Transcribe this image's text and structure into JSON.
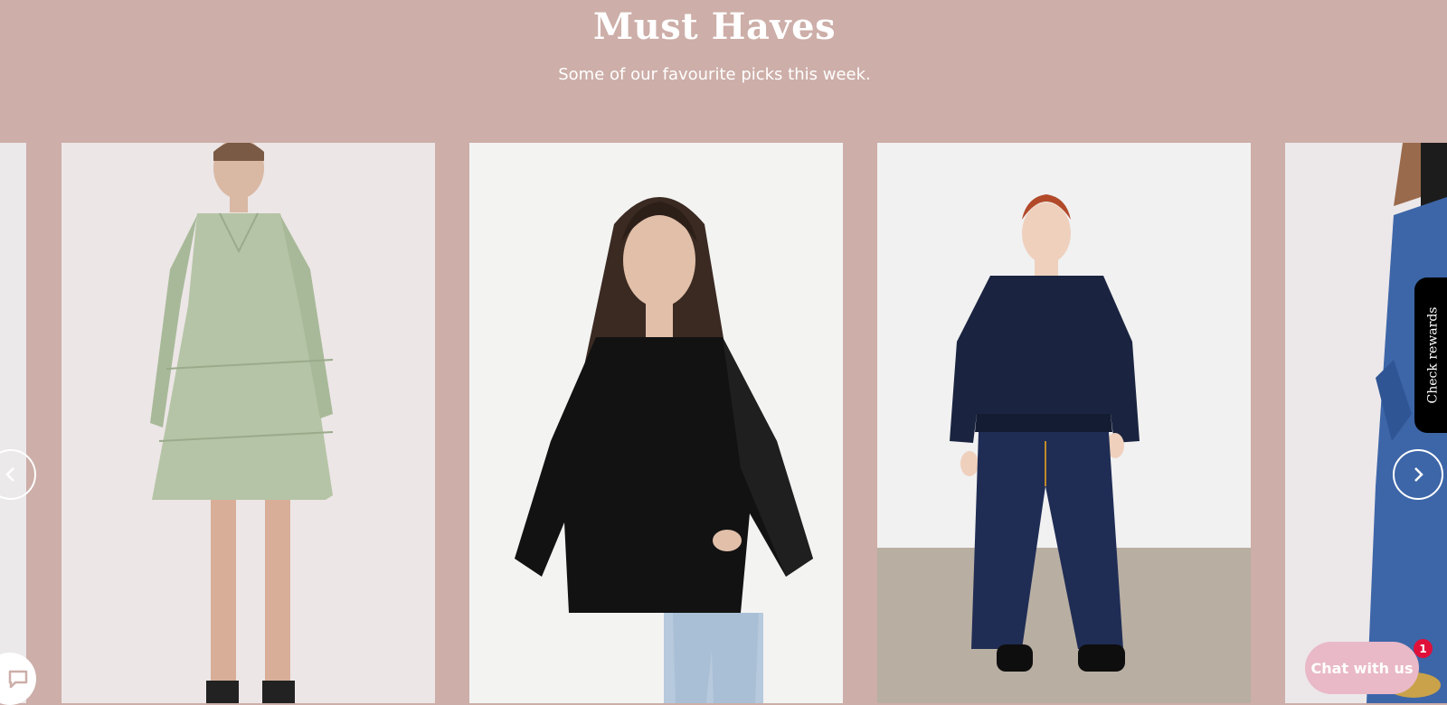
{
  "section": {
    "title": "Must Haves",
    "subtitle": "Some of our favourite picks this week."
  },
  "carousel": {
    "prev_icon": "chevron-left-icon",
    "next_icon": "chevron-right-icon",
    "products": [
      {
        "name": "partial-product-left"
      },
      {
        "name": "sage-tiered-shirt-dress"
      },
      {
        "name": "black-sheer-sleeve-blouse"
      },
      {
        "name": "navy-cable-knit-sweater"
      },
      {
        "name": "partial-product-right"
      }
    ]
  },
  "widgets": {
    "rewards_label": "Check rewards",
    "chat_label": "Chat with us",
    "chat_badge": "1",
    "chat_icon": "chat-bubble-icon"
  },
  "colors": {
    "background": "#cdaea8",
    "text": "#ffffff",
    "chat_button": "#e9b9c7",
    "badge": "#e0103a",
    "rewards_tab": "#000000"
  }
}
